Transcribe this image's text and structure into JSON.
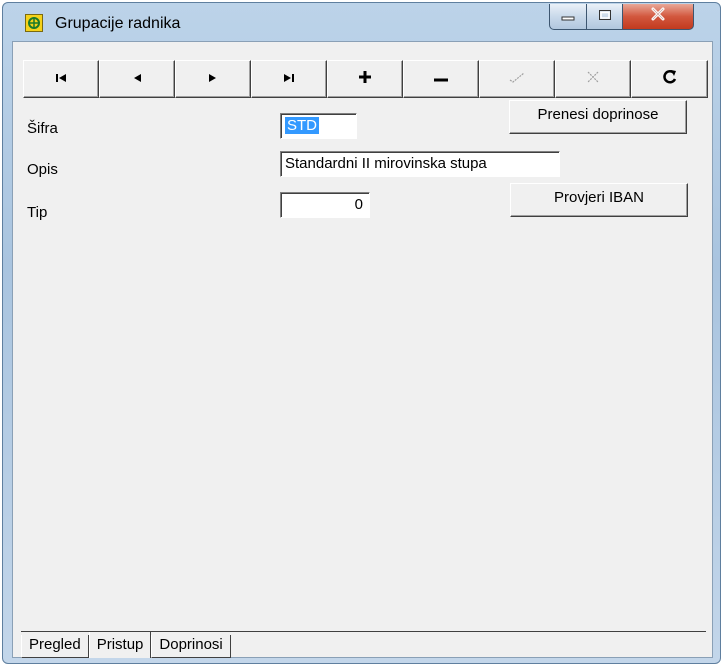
{
  "window": {
    "title": "Grupacije radnika"
  },
  "navigator": {
    "buttons": [
      {
        "name": "first",
        "icon": "first-record-icon",
        "enabled": true
      },
      {
        "name": "prior",
        "icon": "prior-record-icon",
        "enabled": true
      },
      {
        "name": "next",
        "icon": "next-record-icon",
        "enabled": true
      },
      {
        "name": "last",
        "icon": "last-record-icon",
        "enabled": true
      },
      {
        "name": "insert",
        "icon": "plus-icon",
        "enabled": true
      },
      {
        "name": "delete",
        "icon": "minus-icon",
        "enabled": true
      },
      {
        "name": "post",
        "icon": "checkmark-icon",
        "enabled": false
      },
      {
        "name": "cancel",
        "icon": "x-icon",
        "enabled": false
      },
      {
        "name": "refresh",
        "icon": "refresh-icon",
        "enabled": true
      }
    ]
  },
  "form": {
    "sifra_label": "Šifra",
    "sifra_value": "STD",
    "opis_label": "Opis",
    "opis_value": "Standardni II mirovinska stupa",
    "tip_label": "Tip",
    "tip_value": "0"
  },
  "actions": {
    "prenesi_label": "Prenesi doprinose",
    "provjeri_label": "Provjeri IBAN"
  },
  "tabs": [
    {
      "label": "Pregled",
      "active": false
    },
    {
      "label": "Pristup",
      "active": true
    },
    {
      "label": "Doprinosi",
      "active": false
    }
  ],
  "colors": {
    "selection": "#3399ff",
    "disabled_icon": "#a0a0a0"
  }
}
